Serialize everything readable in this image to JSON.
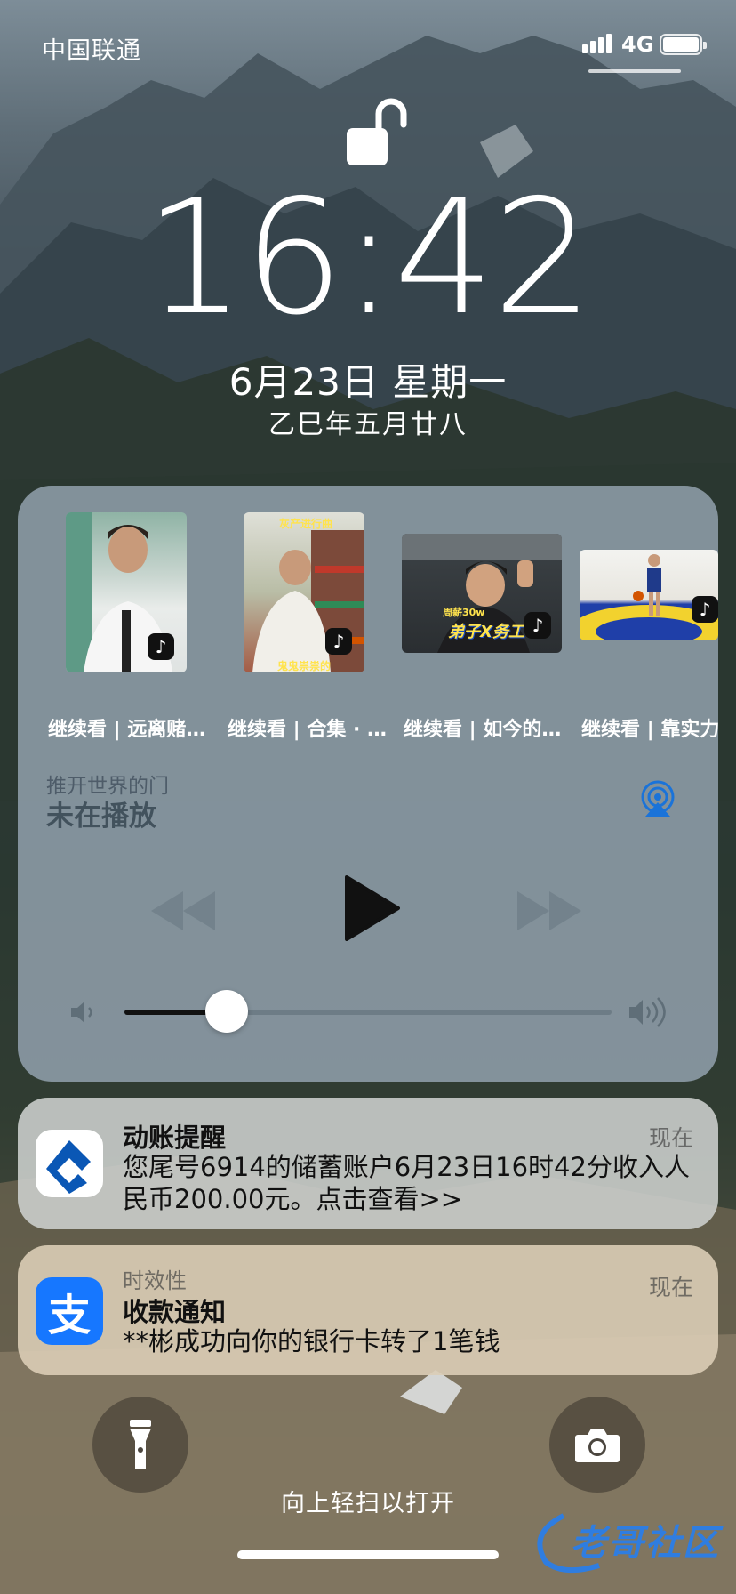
{
  "status_bar": {
    "carrier": "中国联通",
    "network": "4G",
    "battery_level": 1.0
  },
  "lock_screen": {
    "lock_state": "unlocked",
    "time": "16:42",
    "date": "6月23日 星期一",
    "lunar_date": "乙巳年五月廿八"
  },
  "media": {
    "suggestions": [
      {
        "caption": "继续看 | 远离赌…",
        "icon": "tiktok-icon"
      },
      {
        "caption": "继续看 | 合集 · …",
        "icon": "tiktok-icon"
      },
      {
        "caption": "继续看 | 如今的…",
        "icon": "tiktok-icon"
      },
      {
        "caption": "继续看 | 靠实力",
        "icon": "tiktok-icon"
      }
    ],
    "thumb_texts": {
      "t2_top": "灰产进行曲",
      "t2_bottom": "鬼鬼祟祟的",
      "t3_top": "周薪30w",
      "t3_mid": "弟子X务工"
    },
    "source_app": "推开世界的门",
    "now_playing": "未在播放",
    "volume_level": 0.21
  },
  "notifications": [
    {
      "app": "bank",
      "title": "动账提醒",
      "time": "现在",
      "body": "您尾号6914的储蓄账户6月23日16时42分收入人民币200.00元。点击查看>>"
    },
    {
      "app": "alipay",
      "category": "时效性",
      "title": "收款通知",
      "time": "现在",
      "body": "**彬成功向你的银行卡转了1笔钱",
      "icon_glyph": "支"
    }
  ],
  "swipe_hint": "向上轻扫以打开",
  "watermark": "老哥社区",
  "colors": {
    "alipay_blue": "#1677ff",
    "bank_blue": "#0a57b5",
    "airplay_blue": "#1a73d9"
  }
}
